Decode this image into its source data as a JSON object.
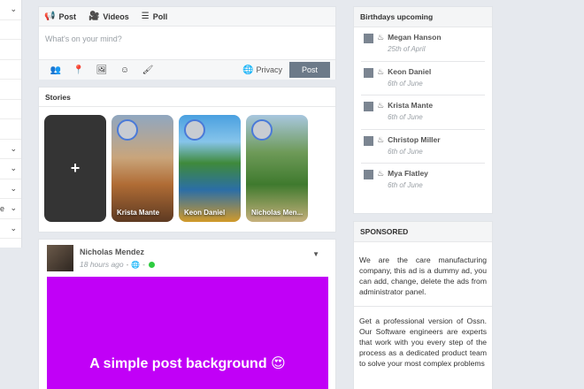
{
  "left_sidebar": {
    "rows": [
      {
        "chevron": "⌄",
        "stub": ""
      },
      {
        "chevron": "",
        "stub": ""
      },
      {
        "chevron": "",
        "stub": ""
      },
      {
        "chevron": "",
        "stub": ""
      },
      {
        "chevron": "",
        "stub": ""
      },
      {
        "chevron": "",
        "stub": ""
      },
      {
        "chevron": "",
        "stub": ""
      },
      {
        "chevron": "⌄",
        "stub": ""
      },
      {
        "chevron": "⌄",
        "stub": ""
      },
      {
        "chevron": "⌄",
        "stub": ""
      },
      {
        "chevron": "⌄",
        "stub": "e"
      },
      {
        "chevron": "⌄",
        "stub": ""
      }
    ]
  },
  "composer": {
    "tabs": [
      {
        "icon": "megaphone-icon",
        "glyph": "📢",
        "label": "Post"
      },
      {
        "icon": "video-icon",
        "glyph": "🎥",
        "label": "Videos"
      },
      {
        "icon": "list-icon",
        "glyph": "☰",
        "label": "Poll"
      }
    ],
    "placeholder": "What's on your mind?",
    "tools": [
      {
        "icon": "friends-icon",
        "glyph": "👥"
      },
      {
        "icon": "location-icon",
        "glyph": "📍"
      },
      {
        "icon": "image-icon",
        "glyph": "🖼"
      },
      {
        "icon": "emoji-icon",
        "glyph": "☺"
      },
      {
        "icon": "brush-icon",
        "glyph": "🖌"
      }
    ],
    "privacy_label": "Privacy",
    "post_label": "Post"
  },
  "stories": {
    "title": "Stories",
    "add_label": "+",
    "items": [
      {
        "name": "Krista Mante"
      },
      {
        "name": "Keon Daniel"
      },
      {
        "name": "Nicholas Men..."
      }
    ]
  },
  "post": {
    "author": "Nicholas Mendez",
    "time": "18 hours ago",
    "separator": "-",
    "background_text": "A simple post background 😍",
    "background_color": "#c100f7"
  },
  "birthdays": {
    "title": "Birthdays upcoming",
    "items": [
      {
        "name": "Megan Hanson",
        "date": "25th of April"
      },
      {
        "name": "Keon Daniel",
        "date": "6th of June"
      },
      {
        "name": "Krista Mante",
        "date": "6th of June"
      },
      {
        "name": "Christop Miller",
        "date": "6th of June"
      },
      {
        "name": "Mya Flatley",
        "date": "6th of June"
      }
    ]
  },
  "sponsored": {
    "title": "SPONSORED",
    "paragraph1": "We are the care manufacturing company, this ad is a dummy ad, you can add, change, delete the ads from administrator panel.",
    "paragraph2": "Get a professional version of Ossn. Our Software engineers are experts that work with you every step of the process as a dedicated product team to solve your most complex problems"
  }
}
